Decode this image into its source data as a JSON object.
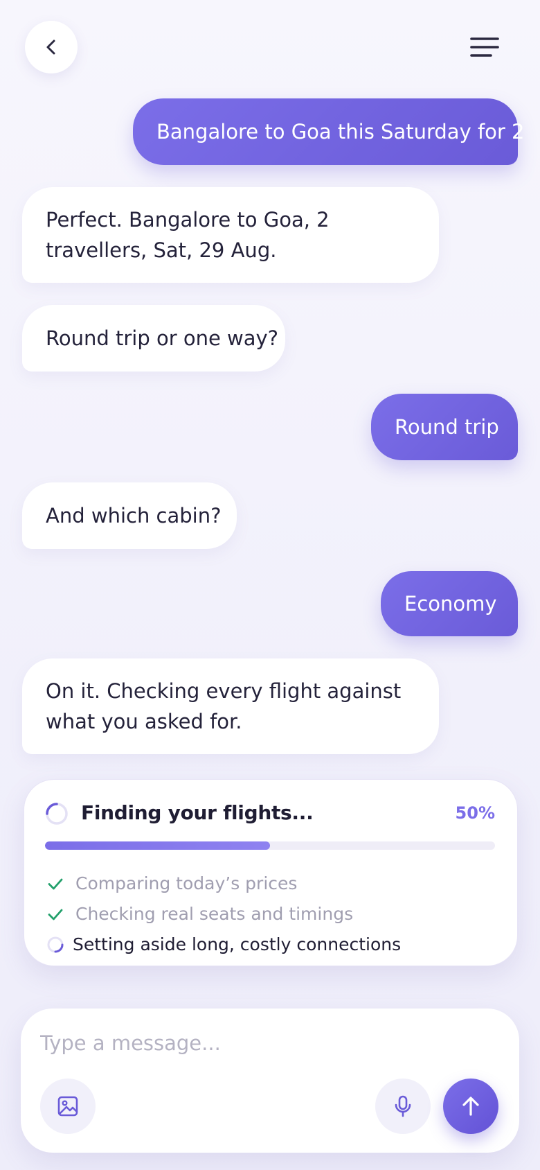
{
  "header": {
    "back_icon": "chevron-left-icon",
    "menu_icon": "hamburger-menu-icon"
  },
  "messages": [
    {
      "sender": "user",
      "text": "Bangalore to Goa this Saturday for 2"
    },
    {
      "sender": "bot",
      "text": "Perfect. Bangalore to Goa, 2 travellers, Sat, 29 Aug."
    },
    {
      "sender": "bot",
      "text": "Round trip or one way?"
    },
    {
      "sender": "user",
      "text": "Round trip"
    },
    {
      "sender": "bot",
      "text": "And which cabin?"
    },
    {
      "sender": "user",
      "text": "Economy"
    },
    {
      "sender": "bot",
      "text": "On it. Checking every flight against what you asked for."
    }
  ],
  "search_status": {
    "title": "Finding your flights...",
    "percent_label": "50%",
    "progress": 0.5,
    "steps": [
      {
        "label": "Comparing today’s prices",
        "state": "done"
      },
      {
        "label": "Checking real seats and timings",
        "state": "done"
      },
      {
        "label": "Setting aside long, costly connections",
        "state": "in-progress"
      }
    ]
  },
  "composer": {
    "placeholder": "Type a message...",
    "attach_icon": "image-icon",
    "mic_icon": "microphone-icon",
    "send_icon": "arrow-up-icon"
  },
  "colors": {
    "accent": "#7b6ee8",
    "accent_dark": "#6a5bd8",
    "background": "#f4f3fc",
    "success": "#22a06b",
    "text_primary": "#24223a",
    "text_muted": "#a09eb0"
  }
}
